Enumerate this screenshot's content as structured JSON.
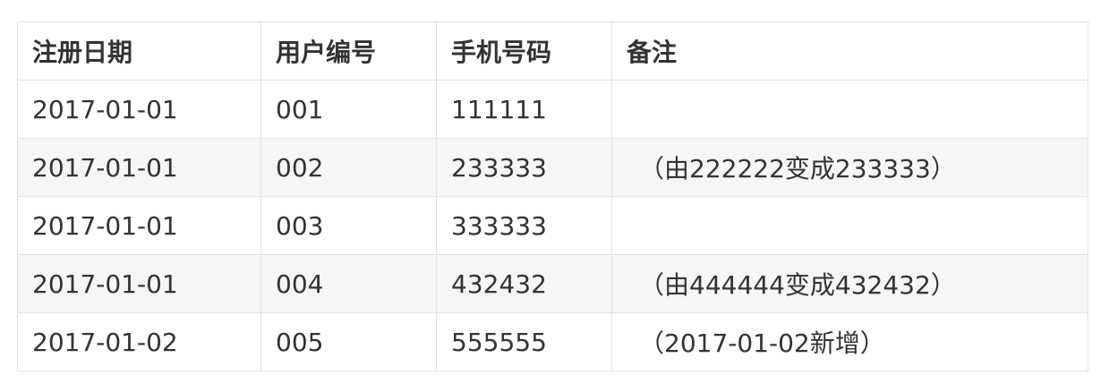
{
  "table": {
    "headers": [
      "注册日期",
      "用户编号",
      "手机号码",
      "备注"
    ],
    "rows": [
      [
        "2017-01-01",
        "001",
        "111111",
        ""
      ],
      [
        "2017-01-01",
        "002",
        "233333",
        "（由222222变成233333）"
      ],
      [
        "2017-01-01",
        "003",
        "333333",
        ""
      ],
      [
        "2017-01-01",
        "004",
        "432432",
        "（由444444变成432432）"
      ],
      [
        "2017-01-02",
        "005",
        "555555",
        "（2017-01-02新增）"
      ]
    ]
  }
}
